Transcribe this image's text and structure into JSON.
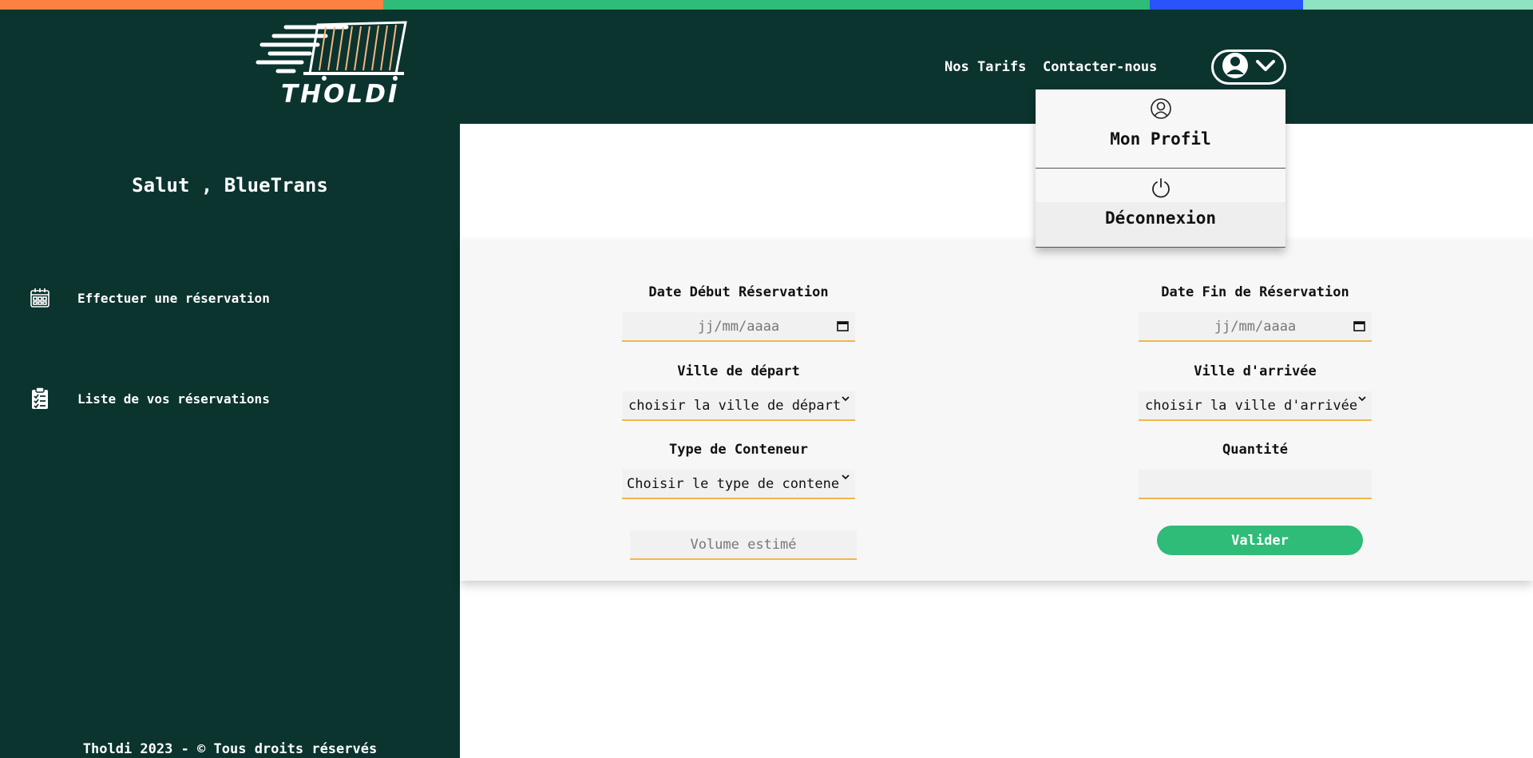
{
  "colors": {
    "sidebar_bg": "#0b342f",
    "accent_green": "#2fbb78",
    "strip": [
      "#ff8142",
      "#2fbb78",
      "#2953ff",
      "#8de3c2"
    ],
    "field_underline": "#f0b84a"
  },
  "brand": {
    "name": "THOLDI"
  },
  "sidebar": {
    "greeting": "Salut , BlueTrans",
    "items": [
      {
        "label": "Effectuer une réservation",
        "icon": "calendar-icon"
      },
      {
        "label": "Liste de vos réservations",
        "icon": "clipboard-list-icon"
      }
    ],
    "footer": "Tholdi 2023 - © Tous droits réservés"
  },
  "nav": {
    "links": [
      "Nos Tarifs",
      "Contacter-nous"
    ],
    "user_menu": {
      "icon": "user-circle-icon",
      "items": [
        {
          "label": "Mon Profil",
          "icon": "user-icon"
        },
        {
          "label": "Déconnexion",
          "icon": "power-icon"
        }
      ]
    }
  },
  "form": {
    "start_date": {
      "label": "Date Début Réservation",
      "placeholder": "jj/mm/aaaa"
    },
    "end_date": {
      "label": "Date Fin de Réservation",
      "placeholder": "jj/mm/aaaa"
    },
    "departure": {
      "label": "Ville de départ",
      "value": "choisir la ville de départ"
    },
    "arrival": {
      "label": "Ville d'arrivée",
      "value": "choisir la ville d'arrivée"
    },
    "container_type": {
      "label": "Type de Conteneur",
      "value": "Choisir le type de conteneur"
    },
    "quantity": {
      "label": "Quantité",
      "value": ""
    },
    "volume": {
      "placeholder": "Volume estimé"
    },
    "submit_label": "Valider"
  }
}
